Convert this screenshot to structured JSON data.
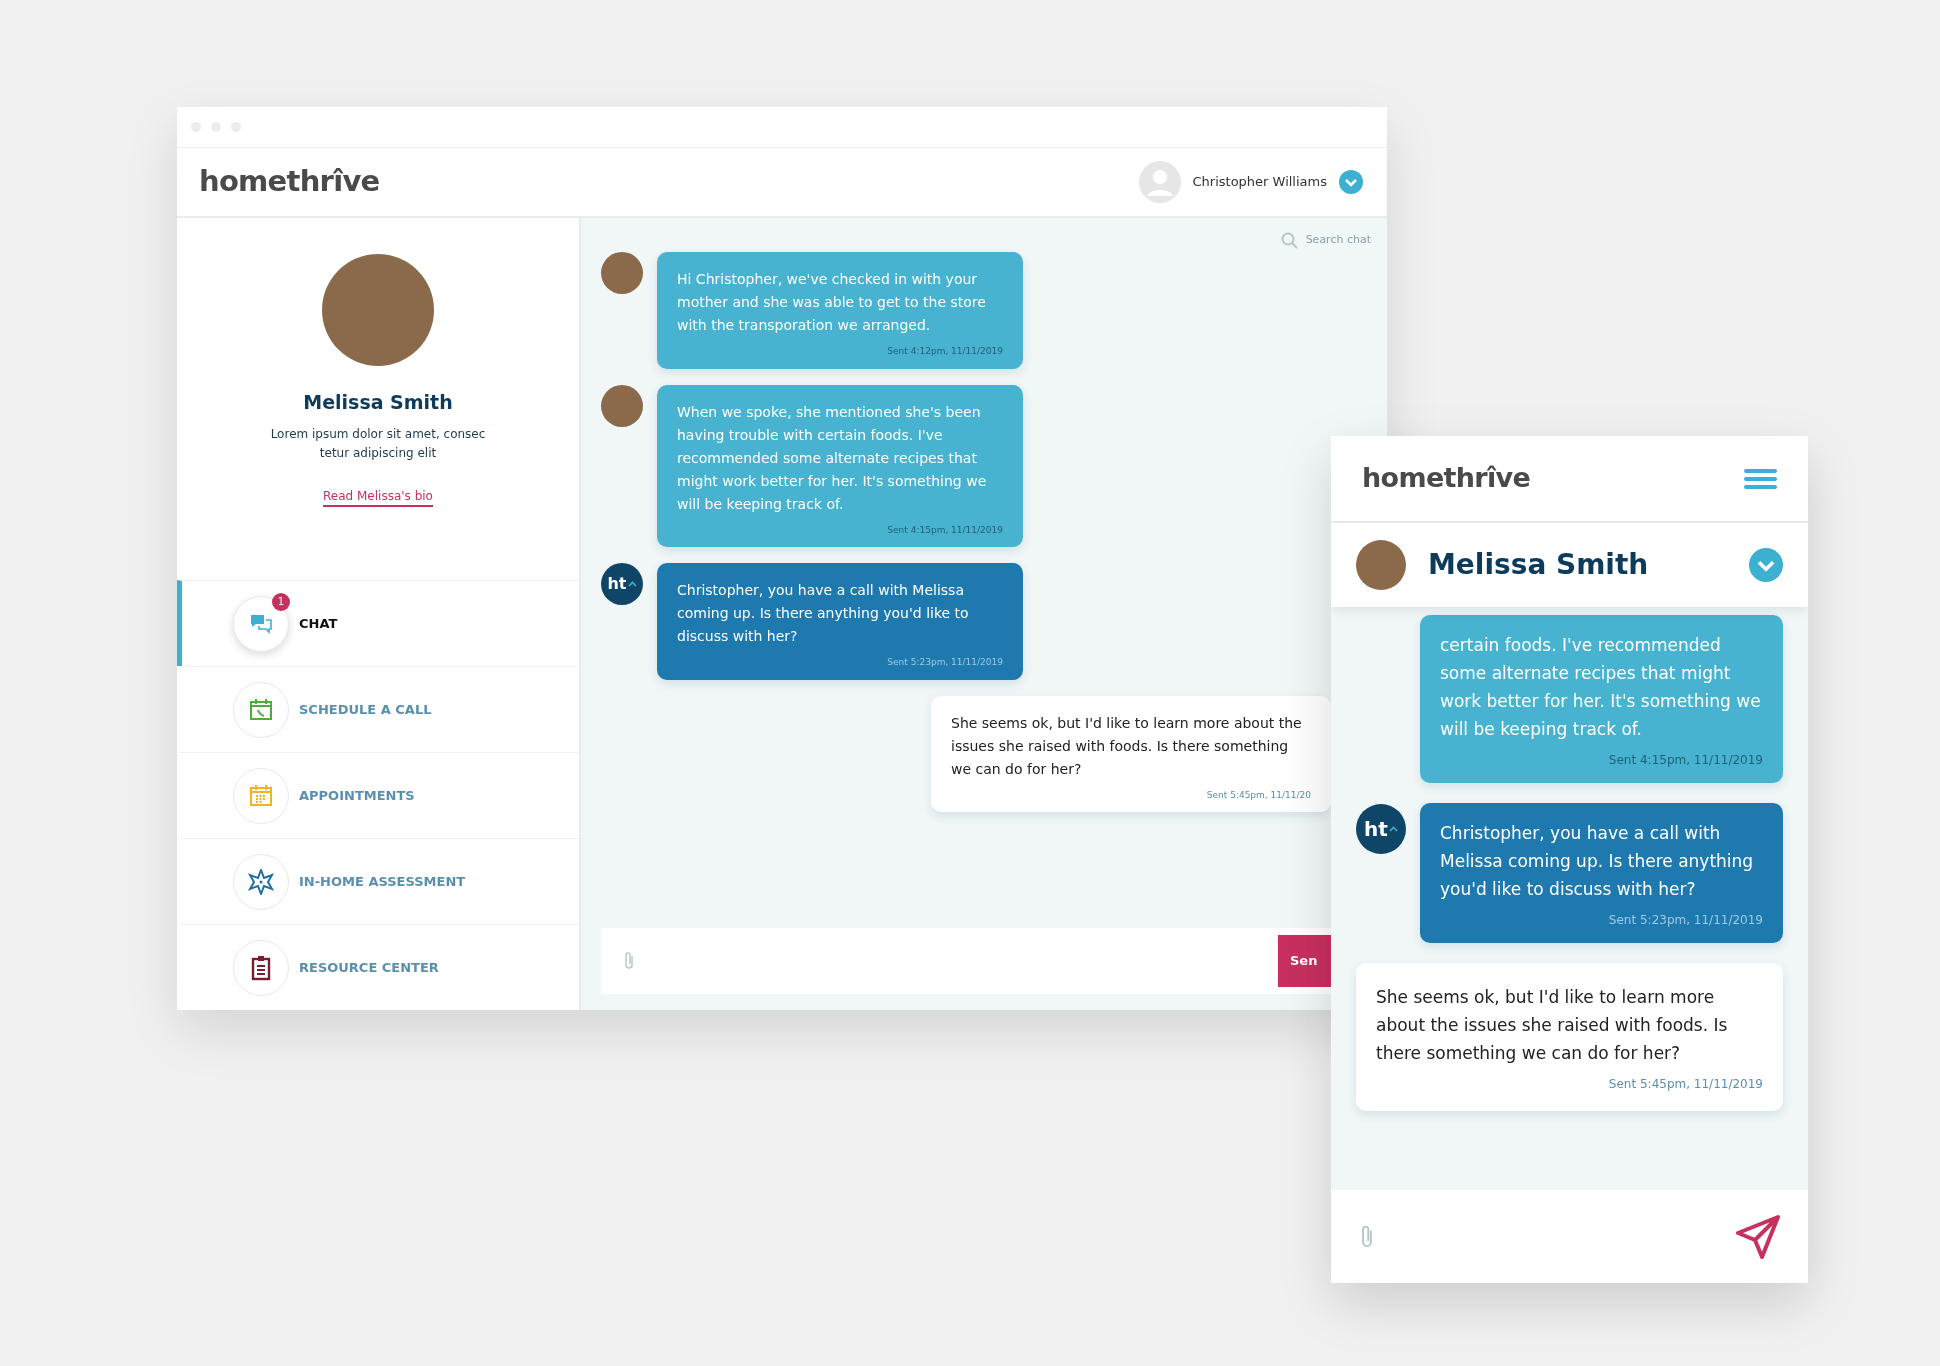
{
  "desktop": {
    "logo": "homethrîve",
    "user": {
      "name": "Christopher Williams"
    },
    "profile": {
      "name": "Melissa Smith",
      "bio": "Lorem ipsum dolor sit amet, consec tetur adipiscing elit",
      "link": "Read Melissa's bio"
    },
    "nav": [
      {
        "kind": "chat",
        "label": "CHAT",
        "selected": true,
        "badge": "1"
      },
      {
        "kind": "call",
        "label": "SCHEDULE A CALL",
        "selected": false
      },
      {
        "kind": "appointments",
        "label": "APPOINTMENTS",
        "selected": false
      },
      {
        "kind": "assessment",
        "label": "IN-HOME ASSESSMENT",
        "selected": false
      },
      {
        "kind": "resources",
        "label": "RESOURCE CENTER",
        "selected": false
      }
    ],
    "search": {
      "placeholder": "Search chat"
    },
    "messages": [
      {
        "kind": "agent",
        "photo": true,
        "text": "Hi Christopher, we've checked in with your mother and she was able to get to the store with the transporation we arranged.",
        "time": "Sent 4:12pm, 11/11/2019"
      },
      {
        "kind": "agent",
        "photo": true,
        "text": "When we spoke, she mentioned she's been having trouble with certain foods. I've recommended some alternate recipes that might work better for her. It's something we will be keeping track of.",
        "time": "Sent 4:15pm, 11/11/2019"
      },
      {
        "kind": "system",
        "avatar": "ht",
        "text": "Christopher, you have a call with Melissa coming up. Is there anything you'd like to discuss with her?",
        "time": "Sent 5:23pm, 11/11/2019"
      },
      {
        "kind": "user",
        "text": "She seems ok, but I'd like to learn more about the issues she raised with foods. Is there something we can do for her?",
        "time": "Sent 5:45pm, 11/11/20"
      }
    ],
    "composer": {
      "send": "Sen"
    }
  },
  "mobile": {
    "logo": "homethrîve",
    "contact": {
      "name": "Melissa Smith"
    },
    "messages": [
      {
        "kind": "agent",
        "text": "certain foods. I've recommended some alternate recipes that might work better for her. It's something we will be keeping track of.",
        "time": "Sent 4:15pm, 11/11/2019"
      },
      {
        "kind": "system",
        "avatar": "ht",
        "text": "Christopher, you have a call with Melissa coming up. Is there anything you'd like to discuss with her?",
        "time": "Sent 5:23pm, 11/11/2019"
      },
      {
        "kind": "user",
        "text": "She seems ok, but I'd like to learn more about the issues she raised with foods. Is there something we can do for her?",
        "time": "Sent 5:45pm, 11/11/2019"
      }
    ]
  }
}
